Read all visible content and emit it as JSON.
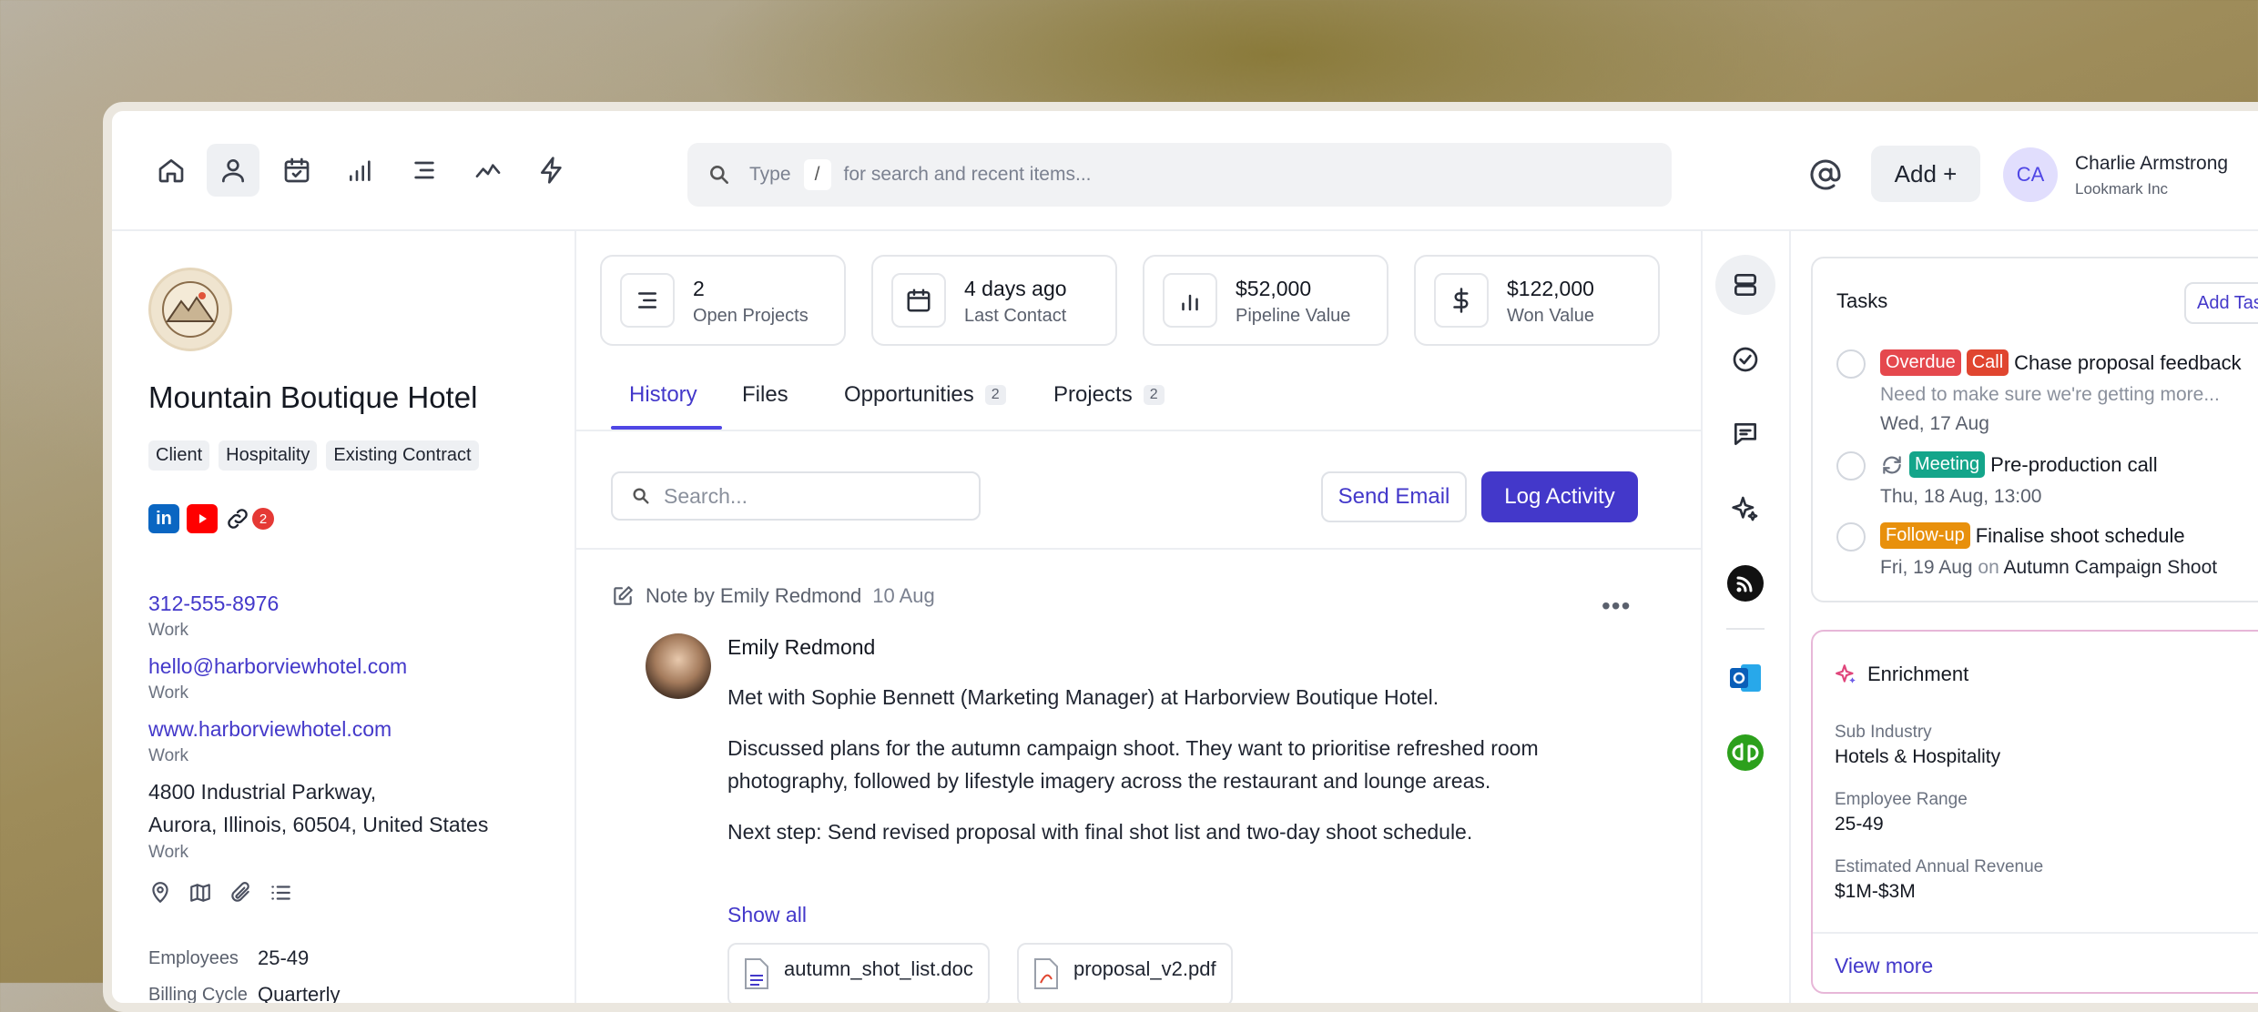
{
  "search": {
    "type_label": "Type",
    "key": "/",
    "hint": "for search and recent items..."
  },
  "header": {
    "add_label": "Add +",
    "avatar_initials": "CA",
    "user_name": "Charlie Armstrong",
    "user_org": "Lookmark Inc"
  },
  "nav": {
    "icons": [
      "home-icon",
      "person-icon",
      "calendar-check-icon",
      "signal-bars-icon",
      "list-icon",
      "trend-line-icon",
      "lightning-icon"
    ]
  },
  "company": {
    "name": "Mountain Boutique Hotel",
    "tags": [
      "Client",
      "Hospitality",
      "Existing Contract"
    ],
    "social_badge": "2",
    "phone": "312-555-8976",
    "phone_type": "Work",
    "email": "hello@harborviewhotel.com",
    "email_type": "Work",
    "website": "www.harborviewhotel.com",
    "website_type": "Work",
    "address_line1": "4800 Industrial Parkway,",
    "address_line2": "Aurora, Illinois, 60504, United States",
    "address_type": "Work",
    "employees_label": "Employees",
    "employees_value": "25-49",
    "billing_label": "Billing Cycle",
    "billing_value": "Quarterly"
  },
  "stats": [
    {
      "value": "2",
      "label": "Open Projects",
      "icon": "lines-icon"
    },
    {
      "value": "4 days ago",
      "label": "Last Contact",
      "icon": "calendar-icon"
    },
    {
      "value": "$52,000",
      "label": "Pipeline Value",
      "icon": "bar-chart-icon"
    },
    {
      "value": "$122,000",
      "label": "Won Value",
      "icon": "dollar-icon"
    }
  ],
  "tabs": [
    {
      "label": "History",
      "count": ""
    },
    {
      "label": "Files",
      "count": ""
    },
    {
      "label": "Opportunities",
      "count": "2"
    },
    {
      "label": "Projects",
      "count": "2"
    }
  ],
  "history": {
    "search_placeholder": "Search...",
    "send_email": "Send Email",
    "log_activity": "Log Activity",
    "note_header": "Note by Emily Redmond",
    "note_date": "10 Aug",
    "author": "Emily Redmond",
    "p1": "Met with Sophie Bennett (Marketing Manager) at Harborview Boutique Hotel.",
    "p2": "Discussed plans for the autumn campaign shoot. They want to prioritise refreshed room photography, followed by lifestyle imagery across the restaurant and lounge areas.",
    "p3": "Next step: Send revised proposal with final shot list and two-day shoot schedule.",
    "show_all": "Show all",
    "files": [
      "autumn_shot_list.doc",
      "proposal_v2.pdf"
    ]
  },
  "tasks": {
    "title": "Tasks",
    "add_label": "Add Task",
    "items": [
      {
        "pill1": "Overdue",
        "pill2": "Call",
        "title": "Chase proposal feedback",
        "sub": "Need to make sure we're getting more...",
        "date": "Wed, 17 Aug"
      },
      {
        "pill1": "Meeting",
        "title": "Pre-production call",
        "date": "Thu, 18 Aug, 13:00"
      },
      {
        "pill1": "Follow-up",
        "title": "Finalise shoot schedule",
        "date": "Fri, 19 Aug",
        "on": "on",
        "project": "Autumn Campaign Shoot"
      }
    ]
  },
  "enrichment": {
    "title": "Enrichment",
    "sub_industry_label": "Sub Industry",
    "sub_industry": "Hotels & Hospitality",
    "employee_range_label": "Employee Range",
    "employee_range": "25-49",
    "revenue_label": "Estimated Annual Revenue",
    "revenue": "$1M-$3M",
    "view_more": "View more"
  },
  "colors": {
    "accent": "#4338ca",
    "overdue": "#e5484d",
    "call": "#e0452f",
    "meeting": "#14a58a",
    "followup": "#e8900c"
  }
}
